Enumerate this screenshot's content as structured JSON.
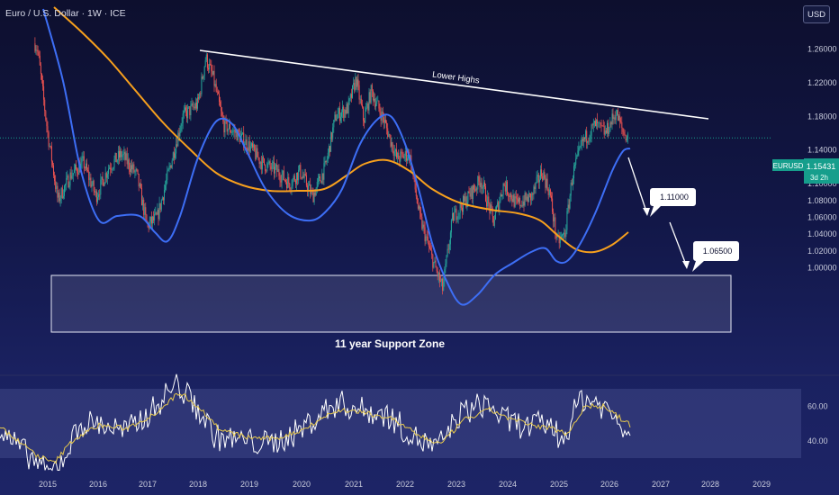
{
  "header": {
    "title": "Euro / U.S. Dollar · 1W · ICE",
    "currency_button": "USD"
  },
  "colors": {
    "up": "#26a69a",
    "down": "#ef5350",
    "ma_fast": "#3d6ef5",
    "ma_slow": "#f7a01d",
    "rsi": "#ffffff",
    "rsi_ma": "#e7c94c",
    "price_tag": "#169e8c"
  },
  "price_tag": {
    "symbol": "EURUSD",
    "price": "1.15431",
    "countdown": "3d 2h"
  },
  "annotations": {
    "trendline_label": "Lower Highs",
    "support_label": "11 year Support Zone",
    "target1": "1.11000",
    "target2": "1.06500"
  },
  "chart_data": [
    {
      "type": "line",
      "x": [
        "2015",
        "2016",
        "2017",
        "2018",
        "2019",
        "2020",
        "2021",
        "2022",
        "2023",
        "2024",
        "2025",
        "2026",
        "2027",
        "2028",
        "2029"
      ],
      "xlim": [
        "2014-09",
        "2029-05"
      ],
      "ylim": [
        0.985,
        1.29
      ],
      "y_ticks": [
        "1.26000",
        "1.22000",
        "1.18000",
        "1.14000",
        "1.12000",
        "1.10000",
        "1.08000",
        "1.06000",
        "1.04000",
        "1.02000",
        "1.00000"
      ],
      "series": [
        {
          "values": [
            1.16,
            1.1,
            1.07,
            1.2,
            1.14,
            1.11,
            1.22,
            1.13,
            1.07,
            1.1,
            1.07,
            1.17
          ]
        },
        {
          "values": [
            1.3,
            1.15,
            1.12,
            1.17,
            1.15,
            1.13,
            1.19,
            1.12,
            1.08,
            1.08,
            1.07,
            1.15
          ]
        }
      ],
      "horizontal_lines": {
        "last_price": 1.15431
      },
      "trendline": {
        "from": [
          "2018-02",
          1.2555
        ],
        "to": [
          "2028-01",
          1.202
        ]
      },
      "support_zone": {
        "from": "2014-09",
        "to": "2028-06",
        "low": 1.0185,
        "high": 1.0615
      },
      "projection_targets": [
        1.11,
        1.065
      ]
    },
    {
      "type": "line",
      "y_ticks": [
        "60.00",
        "40.00"
      ],
      "ylim": [
        22,
        82
      ],
      "band": [
        30,
        70
      ]
    }
  ]
}
